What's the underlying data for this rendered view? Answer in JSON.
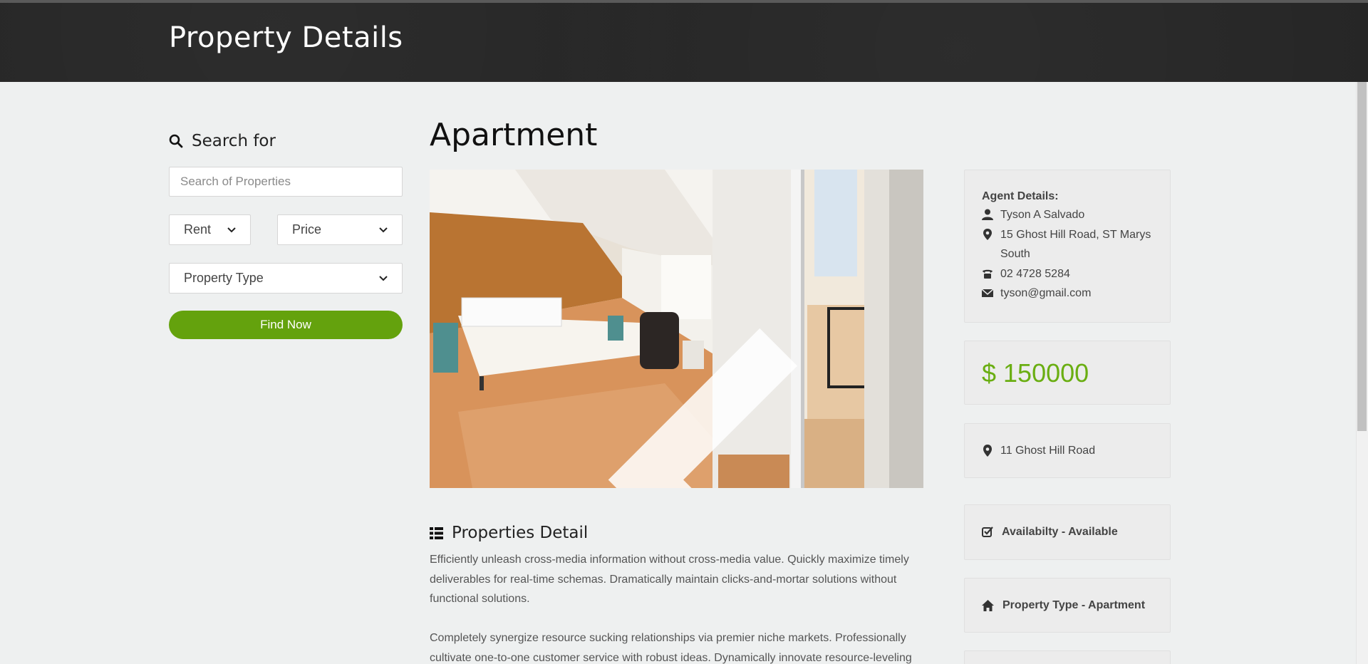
{
  "header": {
    "title": "Property Details"
  },
  "sidebar": {
    "search_heading": "Search for",
    "search_placeholder": "Search of Properties",
    "rent_select": "Rent",
    "price_select": "Price",
    "type_select": "Property Type",
    "find_button": "Find Now"
  },
  "main": {
    "title": "Apartment",
    "detail_heading": "Properties Detail",
    "paragraph1": "Efficiently unleash cross-media information without cross-media value. Quickly maximize timely deliverables for real-time schemas. Dramatically maintain clicks-and-mortar solutions without functional solutions.",
    "paragraph2": "Completely synergize resource sucking relationships via premier niche markets. Professionally cultivate one-to-one customer service with robust ideas. Dynamically innovate resource-leveling"
  },
  "agent": {
    "title": "Agent Details:",
    "name": "Tyson A Salvado",
    "address": "15 Ghost Hill Road, ST Marys South",
    "phone": "02 4728 5284",
    "email": "tyson@gmail.com"
  },
  "price": "$ 150000",
  "location": "11 Ghost Hill Road",
  "availability": "Availabilty - Available",
  "property_type": "Property Type - Apartment",
  "colors": {
    "accent": "#64a20d",
    "price": "#6aae12",
    "header_bg": "#262626"
  },
  "icons": [
    "search-icon",
    "chevron-down-icon",
    "list-icon",
    "user-icon",
    "map-marker-icon",
    "phone-icon",
    "envelope-icon",
    "check-square-icon",
    "home-icon",
    "arrow-left-icon",
    "arrow-right-icon"
  ]
}
